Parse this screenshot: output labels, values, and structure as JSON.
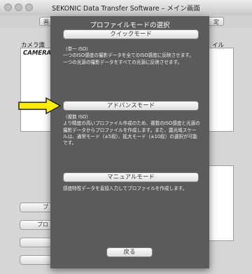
{
  "window": {
    "title": "SEKONIC Data Transfer Software – メイン画面",
    "tab_left_stub": "画",
    "tab_right_stub": "定",
    "camera_label": "カメラ識",
    "camera_value": "CAMERA",
    "right_label": "イル",
    "left_button_stub_1": "プ",
    "left_button_stub_2": "プロ"
  },
  "dialog": {
    "title": "プロファイルモードの選択",
    "quick": {
      "label": "クイックモード",
      "description": "（単一 ISO）\n一つのISO感度の撮影データを全てのISO感度に反映させます。\n一つの光源の撮影データをすべての光源に反映させます。"
    },
    "advanced": {
      "label": "アドバンスモード",
      "description": "（複数 ISO）\nより精度の高いプロファイル作成のため、複数のISO感度と光源の撮影データからプロファイルを作成します。また、露光域スケールは、通常モード（±5段）、拡大モード（±10段）の選択が可能です。"
    },
    "manual": {
      "label": "マニュアルモード",
      "description": "感度特性データを直接入力してプロファイルを作成します。"
    },
    "close_label": "戻る"
  },
  "annotation": {
    "arrow_color": "#ffee00",
    "arrow_icon": "right-arrow-icon"
  }
}
